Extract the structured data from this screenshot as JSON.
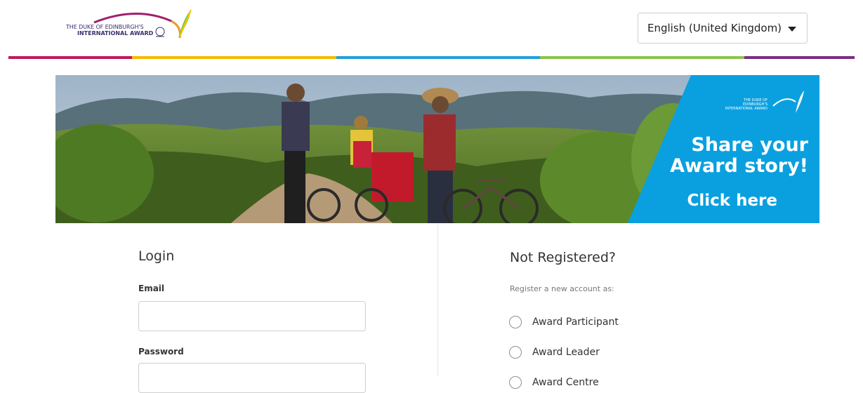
{
  "header": {
    "logo": {
      "line1": "THE DUKE OF EDINBURGH'S",
      "line2": "INTERNATIONAL AWARD",
      "icon": "award-bird-logo-icon"
    },
    "language": {
      "selected": "English (United Kingdom)",
      "caret_icon": "caret-down-icon"
    }
  },
  "brand_colors": [
    "#c2185b",
    "#f5b800",
    "#1fa0db",
    "#8bc34a",
    "#7b2c83"
  ],
  "banner": {
    "logo_line1": "THE DUKE OF EDINBURGH'S",
    "logo_line2": "INTERNATIONAL AWARD",
    "headline_line1": "Share your",
    "headline_line2": "Award story!",
    "cta": "Click here",
    "accent_color": "#0aa0e0"
  },
  "login": {
    "title": "Login",
    "email_label": "Email",
    "email_value": "",
    "password_label": "Password",
    "password_value": ""
  },
  "register": {
    "title": "Not Registered?",
    "subtitle": "Register a new account as:",
    "options": [
      {
        "label": "Award Participant"
      },
      {
        "label": "Award Leader"
      },
      {
        "label": "Award Centre"
      }
    ]
  }
}
